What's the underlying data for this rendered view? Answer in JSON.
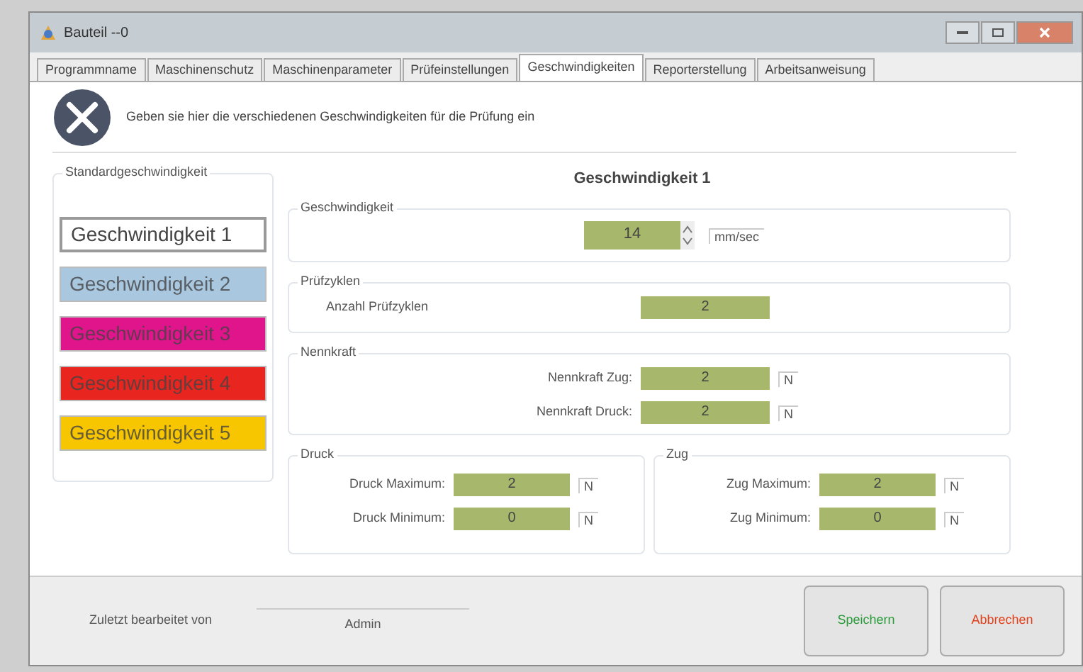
{
  "window": {
    "title": "Bauteil --0"
  },
  "tabs": [
    {
      "label": "Programmname",
      "selected": false
    },
    {
      "label": "Maschinenschutz",
      "selected": false
    },
    {
      "label": "Maschinenparameter",
      "selected": false
    },
    {
      "label": "Prüfeinstellungen",
      "selected": false
    },
    {
      "label": "Geschwindigkeiten",
      "selected": true
    },
    {
      "label": "Reporterstellung",
      "selected": false
    },
    {
      "label": "Arbeitsanweisung",
      "selected": false
    }
  ],
  "header": {
    "text": "Geben sie hier die verschiedenen Geschwindigkeiten für die Prüfung ein"
  },
  "presets": {
    "title": "Standardgeschwindigkeit",
    "items": [
      {
        "label": "Geschwindigkeit 1",
        "color": "#ffffff",
        "selected": true
      },
      {
        "label": "Geschwindigkeit 2",
        "color": "#a9c8e0",
        "selected": false
      },
      {
        "label": "Geschwindigkeit 3",
        "color": "#e0158c",
        "selected": false
      },
      {
        "label": "Geschwindigkeit 4",
        "color": "#e8251f",
        "selected": false
      },
      {
        "label": "Geschwindigkeit 5",
        "color": "#f7c600",
        "selected": false
      }
    ]
  },
  "detail": {
    "title": "Geschwindigkeit 1",
    "speed": {
      "title": "Geschwindigkeit",
      "value": "14",
      "unit": "mm/sec"
    },
    "cycles": {
      "title": "Prüfzyklen",
      "label": "Anzahl Prüfzyklen",
      "value": "2"
    },
    "nominal": {
      "title": "Nennkraft",
      "rows": [
        {
          "label": "Nennkraft Zug:",
          "value": "2",
          "unit": "N"
        },
        {
          "label": "Nennkraft Druck:",
          "value": "2",
          "unit": "N"
        }
      ]
    },
    "limits": [
      {
        "title": "Druck",
        "rows": [
          {
            "label": "Druck Maximum:",
            "value": "2",
            "unit": "N"
          },
          {
            "label": "Druck Minimum:",
            "value": "0",
            "unit": "N"
          }
        ]
      },
      {
        "title": "Zug",
        "rows": [
          {
            "label": "Zug Maximum:",
            "value": "2",
            "unit": "N"
          },
          {
            "label": "Zug Minimum:",
            "value": "0",
            "unit": "N"
          }
        ]
      }
    ]
  },
  "footer": {
    "label": "Zuletzt bearbeitet von",
    "user": "Admin",
    "buttons": [
      {
        "label": "Speichern",
        "kind": "save"
      },
      {
        "label": "Abbrechen",
        "kind": "cancel"
      }
    ]
  }
}
